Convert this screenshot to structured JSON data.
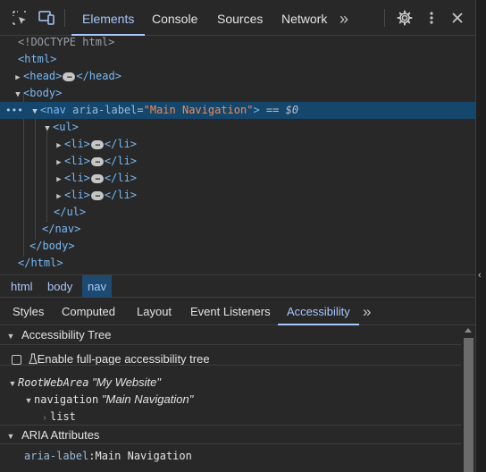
{
  "toolbar": {
    "tabs": [
      "Elements",
      "Console",
      "Sources",
      "Network"
    ],
    "active_tab": "Elements",
    "more_tabs_glyph": "»"
  },
  "tree": {
    "doctype": "<!DOCTYPE html>",
    "html_open": "<html>",
    "head_open": "<head>",
    "head_close": "</head>",
    "body_open": "<body>",
    "nav_open_tag": "<nav",
    "nav_attr_name": "aria-label",
    "nav_attr_eq": "=",
    "nav_attr_value": "\"Main Navigation\"",
    "nav_open_end": ">",
    "selected_marker": "== $0",
    "ul_open": "<ul>",
    "li_open": "<li>",
    "li_close": "</li>",
    "ul_close": "</ul>",
    "nav_close": "</nav>",
    "body_close": "</body>",
    "html_close": "</html>",
    "ellipsis": "…",
    "row_dots": "•••"
  },
  "breadcrumbs": [
    "html",
    "body",
    "nav"
  ],
  "subtabs": {
    "items": [
      "Styles",
      "Computed",
      "Layout",
      "Event Listeners",
      "Accessibility"
    ],
    "active": "Accessibility",
    "more_glyph": "»"
  },
  "accessibility": {
    "tree_section_title": "Accessibility Tree",
    "enable_label": "Enable full-page accessibility tree",
    "root_role": "RootWebArea",
    "root_name": "\"My Website\"",
    "nav_role": "navigation",
    "nav_name": "\"Main Navigation\"",
    "list_role": "list",
    "aria_section_title": "ARIA Attributes",
    "aria_key": "aria-label",
    "aria_colon": ":",
    "aria_value": "Main Navigation"
  },
  "colors": {
    "background": "#282828",
    "accent": "#a8c7fa",
    "selection": "#15466b",
    "tag": "#78b9f4",
    "attr_value": "#f28b54"
  }
}
